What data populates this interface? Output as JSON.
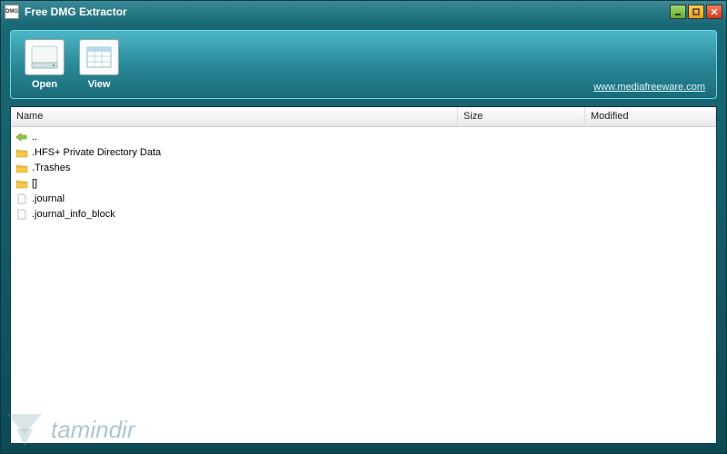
{
  "titlebar": {
    "icon_text": "DMG",
    "title": "Free DMG Extractor"
  },
  "toolbar": {
    "open_label": "Open",
    "view_label": "View",
    "website": "www.mediafreeware.com"
  },
  "columns": {
    "name": "Name",
    "size": "Size",
    "modified": "Modified"
  },
  "rows": [
    {
      "type": "up",
      "name": "..",
      "size": "",
      "modified": ""
    },
    {
      "type": "folder",
      "name": ".HFS+ Private Directory Data",
      "size": "",
      "modified": ""
    },
    {
      "type": "folder",
      "name": ".Trashes",
      "size": "",
      "modified": ""
    },
    {
      "type": "folder",
      "name": "[]",
      "size": "",
      "modified": ""
    },
    {
      "type": "file",
      "name": ".journal",
      "size": "",
      "modified": ""
    },
    {
      "type": "file",
      "name": ".journal_info_block",
      "size": "",
      "modified": ""
    }
  ],
  "watermark": {
    "text": "tamindir"
  }
}
